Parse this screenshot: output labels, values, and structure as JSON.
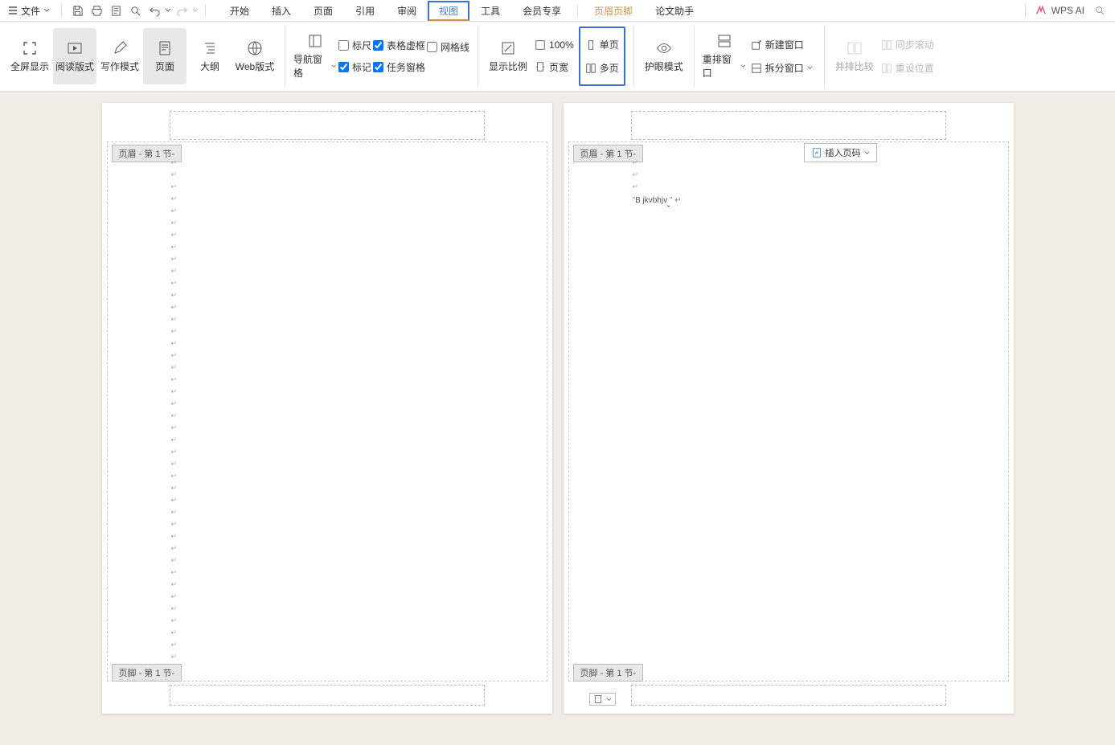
{
  "menu": {
    "file": "文件"
  },
  "tabs": {
    "start": "开始",
    "insert": "插入",
    "page": "页面",
    "ref": "引用",
    "review": "审阅",
    "view": "视图",
    "tools": "工具",
    "member": "会员专享",
    "headerfooter": "页眉页脚",
    "thesis": "论文助手"
  },
  "ai": {
    "label": "WPS AI"
  },
  "ribbon": {
    "fullscreen": "全屏显示",
    "readmode": "阅读版式",
    "writemode": "写作模式",
    "pageview": "页面",
    "outline": "大纲",
    "web": "Web版式",
    "navpane": "导航窗格",
    "ruler": "标尺",
    "tableframe": "表格虚框",
    "grid": "网格线",
    "marks": "标记",
    "taskpane": "任务窗格",
    "showratio": "显示比例",
    "pct": "100%",
    "pagewidth": "页宽",
    "single": "单页",
    "multi": "多页",
    "eye": "护眼模式",
    "rearrange": "重排窗口",
    "newwin": "新建窗口",
    "splitwin": "拆分窗口",
    "sidebyside": "并排比较",
    "syncscroll": "同步滚动",
    "resetpos": "重设位置"
  },
  "doc": {
    "headerTag": "页眉  - 第 1 节-",
    "footerTag": "页脚  - 第 1 节-",
    "insertPageNum": "插入页码",
    "pg2text": "B jkvbhjv"
  }
}
